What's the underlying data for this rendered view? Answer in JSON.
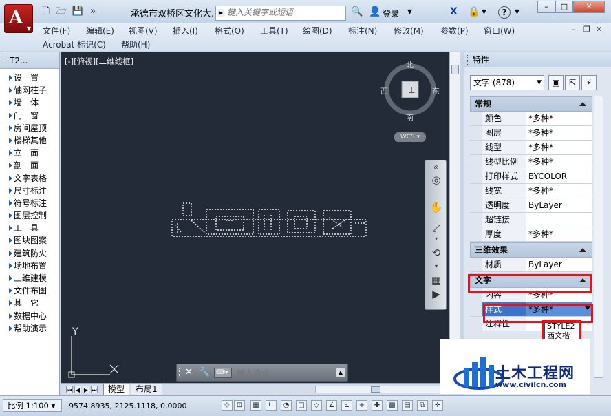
{
  "titlebar": {
    "app_letter": "A",
    "document_title": "承德市双桥区文化大...",
    "search_placeholder": "键入关键字或短语",
    "login_label": "登录",
    "help_label": "?",
    "min_label": "–",
    "max_label": "□",
    "close_label": "✕"
  },
  "menubar": {
    "items_row1": [
      "文件(F)",
      "编辑(E)",
      "视图(V)",
      "插入(I)",
      "格式(O)",
      "工具(T)",
      "绘图(D)",
      "标注(N)",
      "修改(M)",
      "参数(P)",
      "窗口(W)"
    ],
    "items_row2": [
      "Acrobat 标记(C)",
      "帮助(H)"
    ]
  },
  "left_palette": {
    "title": "T2...",
    "items": [
      "设　置",
      "轴网柱子",
      "墙　体",
      "门　窗",
      "房间屋顶",
      "楼梯其他",
      "立　面",
      "剖　面",
      "文字表格",
      "尺寸标注",
      "符号标注",
      "图层控制",
      "工　具",
      "图块图案",
      "建筑防火",
      "场地布置",
      "三维建模",
      "文件布图",
      "其　它",
      "数据中心",
      "帮助演示"
    ]
  },
  "canvas": {
    "view_label": "[-][俯视][二维线框]",
    "viewcube": {
      "north": "北",
      "south": "南",
      "east": "东",
      "west": "西",
      "face": "上"
    },
    "wcs_label": "WCS ▾",
    "ucs_y": "Y",
    "command_placeholder": "键入命令"
  },
  "layout_tabs": [
    "模型",
    "布局1"
  ],
  "statusbar": {
    "scale": "比例 1:100 ▾",
    "coordinates": "9574.8935, 2125.1118, 0.0000"
  },
  "properties": {
    "title": "特性",
    "object_selector": "文字 (878)",
    "categories": [
      {
        "name": "常规",
        "rows": [
          {
            "name": "颜色",
            "value": "*多种*"
          },
          {
            "name": "图层",
            "value": "*多种*"
          },
          {
            "name": "线型",
            "value": "*多种*"
          },
          {
            "name": "线型比例",
            "value": "*多种*"
          },
          {
            "name": "打印样式",
            "value": "BYCOLOR"
          },
          {
            "name": "线宽",
            "value": "*多种*"
          },
          {
            "name": "透明度",
            "value": "ByLayer"
          },
          {
            "name": "超链接",
            "value": ""
          },
          {
            "name": "厚度",
            "value": "*多种*"
          }
        ]
      },
      {
        "name": "三维效果",
        "rows": [
          {
            "name": "材质",
            "value": "ByLayer"
          }
        ]
      },
      {
        "name": "文字",
        "rows": [
          {
            "name": "内容",
            "value": "*多种*"
          },
          {
            "name": "样式",
            "value": "*多种*"
          },
          {
            "name": "注释性",
            "value": ""
          }
        ]
      }
    ],
    "style_dropdown_options": [
      "STYLE2",
      "西文楷"
    ]
  },
  "watermark": {
    "title": "土木工程网",
    "url": "www.civilcn.com"
  },
  "colors": {
    "canvas_bg": "#232b38",
    "highlight_red": "#e1141e",
    "selection_blue": "#3b74c9",
    "watermark_blue": "#0f2a7a"
  }
}
